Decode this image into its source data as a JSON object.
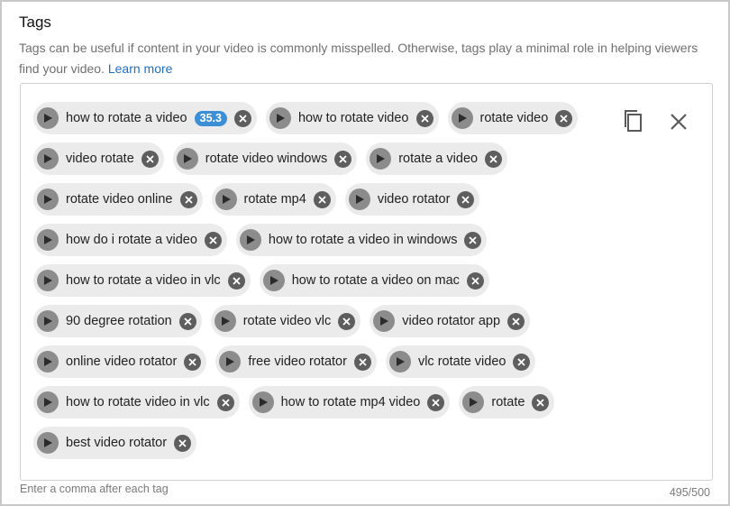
{
  "section": {
    "title": "Tags",
    "description": "Tags can be useful if content in your video is commonly misspelled. Otherwise, tags play a minimal role in helping viewers find your video.",
    "learn_more": "Learn more"
  },
  "tags": [
    {
      "label": "how to rotate a video",
      "badge": "35.3"
    },
    {
      "label": "how to rotate video"
    },
    {
      "label": "rotate video"
    },
    {
      "label": "video rotate"
    },
    {
      "label": "rotate video windows"
    },
    {
      "label": "rotate a video"
    },
    {
      "label": "rotate video online"
    },
    {
      "label": "rotate mp4"
    },
    {
      "label": "video rotator"
    },
    {
      "label": "how do i rotate a video"
    },
    {
      "label": "how to rotate a video in windows"
    },
    {
      "label": "how to rotate a video in vlc"
    },
    {
      "label": "how to rotate a video on mac"
    },
    {
      "label": "90 degree rotation"
    },
    {
      "label": "rotate video vlc"
    },
    {
      "label": "video rotator app"
    },
    {
      "label": "online video rotator"
    },
    {
      "label": "free video rotator"
    },
    {
      "label": "vlc rotate video"
    },
    {
      "label": "how to rotate video in vlc"
    },
    {
      "label": "how to rotate mp4 video"
    },
    {
      "label": "rotate"
    },
    {
      "label": "best video rotator"
    }
  ],
  "actions": {
    "copy_icon": "copy-icon",
    "clear_icon": "close-icon"
  },
  "footer": {
    "hint": "Enter a comma after each tag",
    "counter": "495/500"
  },
  "colors": {
    "chip_background": "#ebebeb",
    "badge": "#3a8fd6",
    "link": "#1e6fc7"
  }
}
